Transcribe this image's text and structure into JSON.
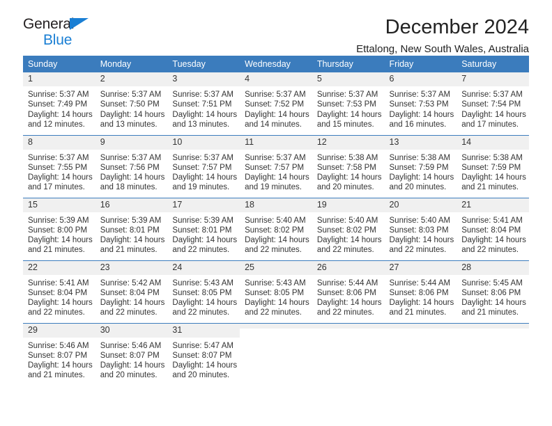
{
  "brand": {
    "name_part1": "General",
    "name_part2": "Blue",
    "triangle_color": "#1a7fd4"
  },
  "header": {
    "title": "December 2024",
    "subtitle": "Ettalong, New South Wales, Australia"
  },
  "theme": {
    "header_bg": "#3b7cbd",
    "daynum_bg": "#f0f0f0",
    "text": "#333333",
    "accent": "#1a7fd4"
  },
  "weekdays": [
    "Sunday",
    "Monday",
    "Tuesday",
    "Wednesday",
    "Thursday",
    "Friday",
    "Saturday"
  ],
  "labels": {
    "sunrise_prefix": "Sunrise:",
    "sunset_prefix": "Sunset:",
    "daylight_prefix": "Daylight:"
  },
  "weeks": [
    [
      {
        "day": "1",
        "sunrise": "Sunrise: 5:37 AM",
        "sunset": "Sunset: 7:49 PM",
        "daylight_l1": "Daylight: 14 hours",
        "daylight_l2": "and 12 minutes."
      },
      {
        "day": "2",
        "sunrise": "Sunrise: 5:37 AM",
        "sunset": "Sunset: 7:50 PM",
        "daylight_l1": "Daylight: 14 hours",
        "daylight_l2": "and 13 minutes."
      },
      {
        "day": "3",
        "sunrise": "Sunrise: 5:37 AM",
        "sunset": "Sunset: 7:51 PM",
        "daylight_l1": "Daylight: 14 hours",
        "daylight_l2": "and 13 minutes."
      },
      {
        "day": "4",
        "sunrise": "Sunrise: 5:37 AM",
        "sunset": "Sunset: 7:52 PM",
        "daylight_l1": "Daylight: 14 hours",
        "daylight_l2": "and 14 minutes."
      },
      {
        "day": "5",
        "sunrise": "Sunrise: 5:37 AM",
        "sunset": "Sunset: 7:53 PM",
        "daylight_l1": "Daylight: 14 hours",
        "daylight_l2": "and 15 minutes."
      },
      {
        "day": "6",
        "sunrise": "Sunrise: 5:37 AM",
        "sunset": "Sunset: 7:53 PM",
        "daylight_l1": "Daylight: 14 hours",
        "daylight_l2": "and 16 minutes."
      },
      {
        "day": "7",
        "sunrise": "Sunrise: 5:37 AM",
        "sunset": "Sunset: 7:54 PM",
        "daylight_l1": "Daylight: 14 hours",
        "daylight_l2": "and 17 minutes."
      }
    ],
    [
      {
        "day": "8",
        "sunrise": "Sunrise: 5:37 AM",
        "sunset": "Sunset: 7:55 PM",
        "daylight_l1": "Daylight: 14 hours",
        "daylight_l2": "and 17 minutes."
      },
      {
        "day": "9",
        "sunrise": "Sunrise: 5:37 AM",
        "sunset": "Sunset: 7:56 PM",
        "daylight_l1": "Daylight: 14 hours",
        "daylight_l2": "and 18 minutes."
      },
      {
        "day": "10",
        "sunrise": "Sunrise: 5:37 AM",
        "sunset": "Sunset: 7:57 PM",
        "daylight_l1": "Daylight: 14 hours",
        "daylight_l2": "and 19 minutes."
      },
      {
        "day": "11",
        "sunrise": "Sunrise: 5:37 AM",
        "sunset": "Sunset: 7:57 PM",
        "daylight_l1": "Daylight: 14 hours",
        "daylight_l2": "and 19 minutes."
      },
      {
        "day": "12",
        "sunrise": "Sunrise: 5:38 AM",
        "sunset": "Sunset: 7:58 PM",
        "daylight_l1": "Daylight: 14 hours",
        "daylight_l2": "and 20 minutes."
      },
      {
        "day": "13",
        "sunrise": "Sunrise: 5:38 AM",
        "sunset": "Sunset: 7:59 PM",
        "daylight_l1": "Daylight: 14 hours",
        "daylight_l2": "and 20 minutes."
      },
      {
        "day": "14",
        "sunrise": "Sunrise: 5:38 AM",
        "sunset": "Sunset: 7:59 PM",
        "daylight_l1": "Daylight: 14 hours",
        "daylight_l2": "and 21 minutes."
      }
    ],
    [
      {
        "day": "15",
        "sunrise": "Sunrise: 5:39 AM",
        "sunset": "Sunset: 8:00 PM",
        "daylight_l1": "Daylight: 14 hours",
        "daylight_l2": "and 21 minutes."
      },
      {
        "day": "16",
        "sunrise": "Sunrise: 5:39 AM",
        "sunset": "Sunset: 8:01 PM",
        "daylight_l1": "Daylight: 14 hours",
        "daylight_l2": "and 21 minutes."
      },
      {
        "day": "17",
        "sunrise": "Sunrise: 5:39 AM",
        "sunset": "Sunset: 8:01 PM",
        "daylight_l1": "Daylight: 14 hours",
        "daylight_l2": "and 22 minutes."
      },
      {
        "day": "18",
        "sunrise": "Sunrise: 5:40 AM",
        "sunset": "Sunset: 8:02 PM",
        "daylight_l1": "Daylight: 14 hours",
        "daylight_l2": "and 22 minutes."
      },
      {
        "day": "19",
        "sunrise": "Sunrise: 5:40 AM",
        "sunset": "Sunset: 8:02 PM",
        "daylight_l1": "Daylight: 14 hours",
        "daylight_l2": "and 22 minutes."
      },
      {
        "day": "20",
        "sunrise": "Sunrise: 5:40 AM",
        "sunset": "Sunset: 8:03 PM",
        "daylight_l1": "Daylight: 14 hours",
        "daylight_l2": "and 22 minutes."
      },
      {
        "day": "21",
        "sunrise": "Sunrise: 5:41 AM",
        "sunset": "Sunset: 8:04 PM",
        "daylight_l1": "Daylight: 14 hours",
        "daylight_l2": "and 22 minutes."
      }
    ],
    [
      {
        "day": "22",
        "sunrise": "Sunrise: 5:41 AM",
        "sunset": "Sunset: 8:04 PM",
        "daylight_l1": "Daylight: 14 hours",
        "daylight_l2": "and 22 minutes."
      },
      {
        "day": "23",
        "sunrise": "Sunrise: 5:42 AM",
        "sunset": "Sunset: 8:04 PM",
        "daylight_l1": "Daylight: 14 hours",
        "daylight_l2": "and 22 minutes."
      },
      {
        "day": "24",
        "sunrise": "Sunrise: 5:43 AM",
        "sunset": "Sunset: 8:05 PM",
        "daylight_l1": "Daylight: 14 hours",
        "daylight_l2": "and 22 minutes."
      },
      {
        "day": "25",
        "sunrise": "Sunrise: 5:43 AM",
        "sunset": "Sunset: 8:05 PM",
        "daylight_l1": "Daylight: 14 hours",
        "daylight_l2": "and 22 minutes."
      },
      {
        "day": "26",
        "sunrise": "Sunrise: 5:44 AM",
        "sunset": "Sunset: 8:06 PM",
        "daylight_l1": "Daylight: 14 hours",
        "daylight_l2": "and 22 minutes."
      },
      {
        "day": "27",
        "sunrise": "Sunrise: 5:44 AM",
        "sunset": "Sunset: 8:06 PM",
        "daylight_l1": "Daylight: 14 hours",
        "daylight_l2": "and 21 minutes."
      },
      {
        "day": "28",
        "sunrise": "Sunrise: 5:45 AM",
        "sunset": "Sunset: 8:06 PM",
        "daylight_l1": "Daylight: 14 hours",
        "daylight_l2": "and 21 minutes."
      }
    ],
    [
      {
        "day": "29",
        "sunrise": "Sunrise: 5:46 AM",
        "sunset": "Sunset: 8:07 PM",
        "daylight_l1": "Daylight: 14 hours",
        "daylight_l2": "and 21 minutes."
      },
      {
        "day": "30",
        "sunrise": "Sunrise: 5:46 AM",
        "sunset": "Sunset: 8:07 PM",
        "daylight_l1": "Daylight: 14 hours",
        "daylight_l2": "and 20 minutes."
      },
      {
        "day": "31",
        "sunrise": "Sunrise: 5:47 AM",
        "sunset": "Sunset: 8:07 PM",
        "daylight_l1": "Daylight: 14 hours",
        "daylight_l2": "and 20 minutes."
      },
      {
        "day": "",
        "sunrise": "",
        "sunset": "",
        "daylight_l1": "",
        "daylight_l2": ""
      },
      {
        "day": "",
        "sunrise": "",
        "sunset": "",
        "daylight_l1": "",
        "daylight_l2": ""
      },
      {
        "day": "",
        "sunrise": "",
        "sunset": "",
        "daylight_l1": "",
        "daylight_l2": ""
      },
      {
        "day": "",
        "sunrise": "",
        "sunset": "",
        "daylight_l1": "",
        "daylight_l2": ""
      }
    ]
  ]
}
